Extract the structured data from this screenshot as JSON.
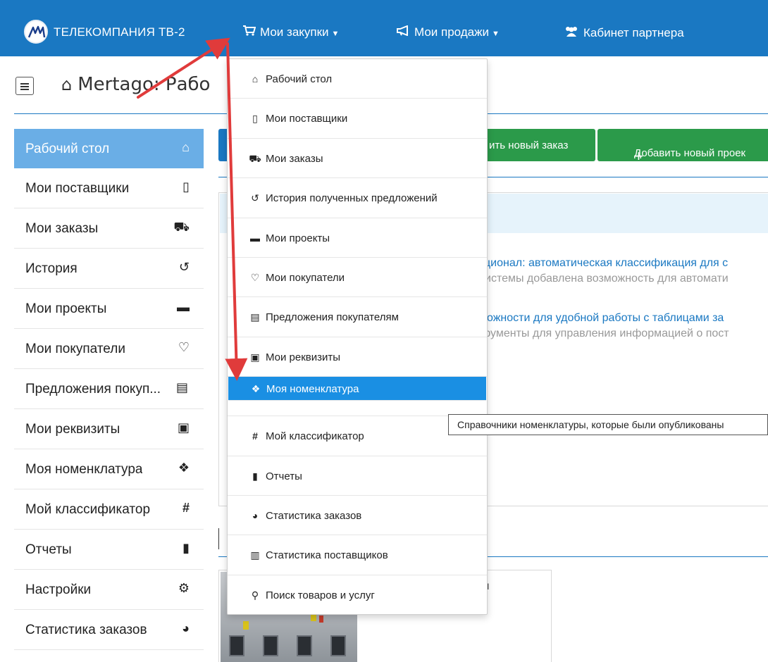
{
  "navbar": {
    "brand": "ТЕЛЕКОМПАНИЯ ТВ-2",
    "items": [
      {
        "label": "Мои закупки",
        "icon": "cart-icon",
        "has_caret": true
      },
      {
        "label": "Мои продажи",
        "icon": "bullhorn-icon",
        "has_caret": true
      },
      {
        "label": "Кабинет партнера",
        "icon": "users-icon",
        "has_caret": false
      }
    ]
  },
  "header": {
    "title": "Mertago: Рабо"
  },
  "sidebar": {
    "items": [
      {
        "label": "Рабочий стол",
        "icon": "home-icon",
        "active": true
      },
      {
        "label": "Мои поставщики",
        "icon": "building-icon"
      },
      {
        "label": "Мои заказы",
        "icon": "cart-icon"
      },
      {
        "label": "История",
        "icon": "history-icon"
      },
      {
        "label": "Мои проекты",
        "icon": "briefcase-icon"
      },
      {
        "label": "Мои покупатели",
        "icon": "handshake-icon"
      },
      {
        "label": "Предложения покуп...",
        "icon": "document-icon"
      },
      {
        "label": "Мои реквизиты",
        "icon": "id-card-icon"
      },
      {
        "label": "Моя номенклатура",
        "icon": "cubes-icon"
      },
      {
        "label": "Мой классификатор",
        "icon": "hash-icon"
      },
      {
        "label": "Отчеты",
        "icon": "file-icon"
      },
      {
        "label": "Настройки",
        "icon": "gears-icon"
      },
      {
        "label": "Статистика заказов",
        "icon": "pie-chart-icon"
      }
    ]
  },
  "main": {
    "button_new_order": "ить новый заказ",
    "button_new_project": "Добавить новый проек",
    "news": [
      {
        "title": "кционал: автоматическая классификация для с",
        "desc": "системы добавлена возможность для автомати"
      },
      {
        "title": "можности для удобной работы с таблицами за",
        "desc": "трументы для управления информацией о пост"
      }
    ],
    "card_text": "ы"
  },
  "dropdown": {
    "items": [
      {
        "label": "Рабочий стол",
        "icon": "home-icon"
      },
      {
        "label": "Мои поставщики",
        "icon": "building-icon"
      },
      {
        "label": "Мои заказы",
        "icon": "cart-icon"
      },
      {
        "label": "История полученных предложений",
        "icon": "history-icon"
      },
      {
        "label": "Мои проекты",
        "icon": "briefcase-icon"
      },
      {
        "label": "Мои покупатели",
        "icon": "handshake-icon"
      },
      {
        "label": "Предложения покупателям",
        "icon": "document-icon"
      },
      {
        "label": "Мои реквизиты",
        "icon": "id-card-icon"
      },
      {
        "label": "Моя номенклатура",
        "icon": "cubes-icon",
        "active": true
      },
      {
        "label": "Мой классификатор",
        "icon": "hash-icon"
      },
      {
        "label": "Отчеты",
        "icon": "file-icon"
      },
      {
        "label": "Статистика заказов",
        "icon": "pie-chart-icon"
      },
      {
        "label": "Статистика поставщиков",
        "icon": "bar-chart-icon"
      },
      {
        "label": "Поиск товаров и услуг",
        "icon": "search-icon"
      }
    ]
  },
  "tooltip": {
    "text": "Справочники номенклатуры, которые были опубликованы"
  },
  "colors": {
    "navbar": "#1a78c2",
    "sidebar_active": "#6aaee6",
    "dropdown_active": "#1a8fe3",
    "green": "#2b9a4a",
    "arrow": "#e03b3b"
  }
}
